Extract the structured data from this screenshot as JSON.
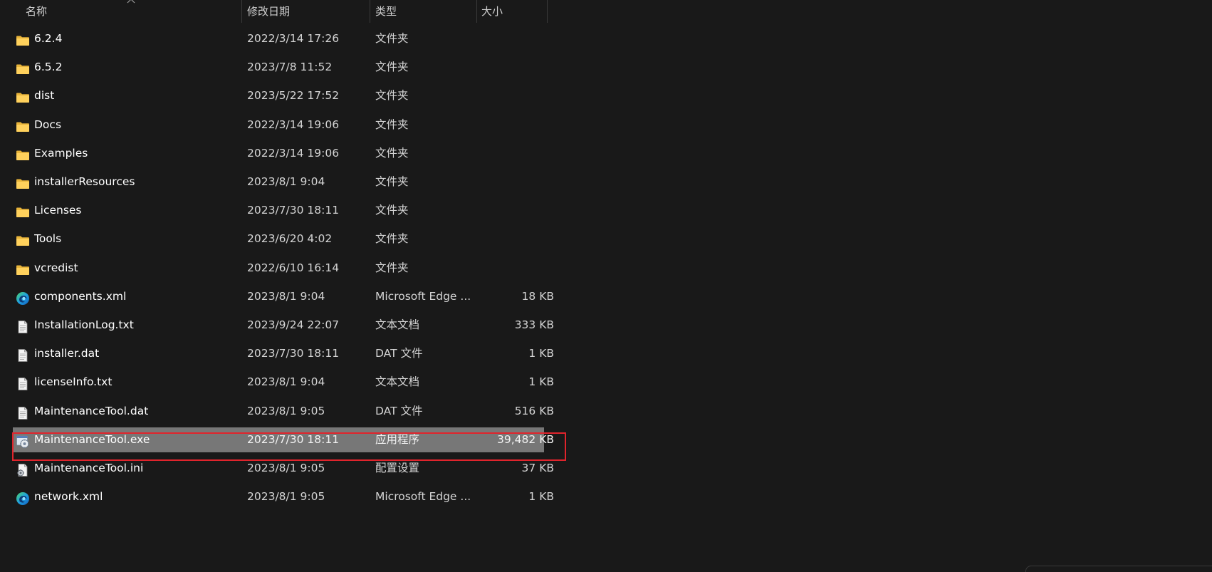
{
  "columns": {
    "name": "名称",
    "date": "修改日期",
    "type": "类型",
    "size": "大小"
  },
  "files": [
    {
      "name": "6.2.4",
      "date": "2022/3/14 17:26",
      "type": "文件夹",
      "size": "",
      "icon": "folder-icon"
    },
    {
      "name": "6.5.2",
      "date": "2023/7/8 11:52",
      "type": "文件夹",
      "size": "",
      "icon": "folder-icon"
    },
    {
      "name": "dist",
      "date": "2023/5/22 17:52",
      "type": "文件夹",
      "size": "",
      "icon": "folder-icon"
    },
    {
      "name": "Docs",
      "date": "2022/3/14 19:06",
      "type": "文件夹",
      "size": "",
      "icon": "folder-icon"
    },
    {
      "name": "Examples",
      "date": "2022/3/14 19:06",
      "type": "文件夹",
      "size": "",
      "icon": "folder-icon"
    },
    {
      "name": "installerResources",
      "date": "2023/8/1 9:04",
      "type": "文件夹",
      "size": "",
      "icon": "folder-icon"
    },
    {
      "name": "Licenses",
      "date": "2023/7/30 18:11",
      "type": "文件夹",
      "size": "",
      "icon": "folder-icon"
    },
    {
      "name": "Tools",
      "date": "2023/6/20 4:02",
      "type": "文件夹",
      "size": "",
      "icon": "folder-icon"
    },
    {
      "name": "vcredist",
      "date": "2022/6/10 16:14",
      "type": "文件夹",
      "size": "",
      "icon": "folder-icon"
    },
    {
      "name": "components.xml",
      "date": "2023/8/1 9:04",
      "type": "Microsoft Edge ...",
      "size": "18 KB",
      "icon": "edge-icon"
    },
    {
      "name": "InstallationLog.txt",
      "date": "2023/9/24 22:07",
      "type": "文本文档",
      "size": "333 KB",
      "icon": "document-icon"
    },
    {
      "name": "installer.dat",
      "date": "2023/7/30 18:11",
      "type": "DAT 文件",
      "size": "1 KB",
      "icon": "document-icon"
    },
    {
      "name": "licenseInfo.txt",
      "date": "2023/8/1 9:04",
      "type": "文本文档",
      "size": "1 KB",
      "icon": "document-icon"
    },
    {
      "name": "MaintenanceTool.dat",
      "date": "2023/8/1 9:05",
      "type": "DAT 文件",
      "size": "516 KB",
      "icon": "document-icon"
    },
    {
      "name": "MaintenanceTool.exe",
      "date": "2023/7/30 18:11",
      "type": "应用程序",
      "size": "39,482 KB",
      "icon": "application-icon",
      "selected": true
    },
    {
      "name": "MaintenanceTool.ini",
      "date": "2023/8/1 9:05",
      "type": "配置设置",
      "size": "37 KB",
      "icon": "settings-file-icon"
    },
    {
      "name": "network.xml",
      "date": "2023/8/1 9:05",
      "type": "Microsoft Edge ...",
      "size": "1 KB",
      "icon": "edge-icon"
    }
  ],
  "colors": {
    "background": "#191919",
    "selection": "#777777",
    "highlight_border": "#e0242c",
    "folder": "#f4c542"
  }
}
